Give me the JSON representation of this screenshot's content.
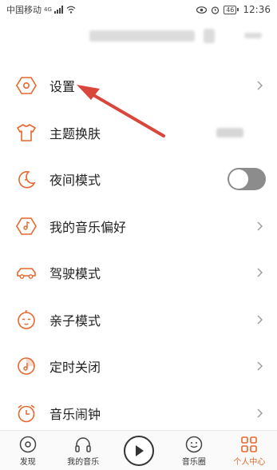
{
  "status_bar": {
    "carrier": "中国移动",
    "network": "4G",
    "battery": "46",
    "time": "12:36"
  },
  "menu": [
    {
      "key": "settings",
      "label": "设置",
      "icon": "hexagon-settings-icon",
      "control": "chevron"
    },
    {
      "key": "theme",
      "label": "主题换肤",
      "icon": "tshirt-icon",
      "control": "value"
    },
    {
      "key": "night",
      "label": "夜间模式",
      "icon": "moon-icon",
      "control": "toggle",
      "toggle_on": false
    },
    {
      "key": "preference",
      "label": "我的音乐偏好",
      "icon": "hexagon-music-icon",
      "control": "chevron"
    },
    {
      "key": "driving",
      "label": "驾驶模式",
      "icon": "car-icon",
      "control": "chevron"
    },
    {
      "key": "kids",
      "label": "亲子模式",
      "icon": "baby-face-icon",
      "control": "chevron"
    },
    {
      "key": "timer",
      "label": "定时关闭",
      "icon": "timer-icon",
      "control": "chevron"
    },
    {
      "key": "alarm",
      "label": "音乐闹钟",
      "icon": "alarm-clock-icon",
      "control": "chevron"
    }
  ],
  "bottom_nav": {
    "discover": "发现",
    "my_music": "我的音乐",
    "music_circle": "音乐圈",
    "profile": "个人中心"
  },
  "colors": {
    "accent": "#e8672d",
    "arrow": "#d9463b",
    "toggle_off": "#8c8c8c"
  }
}
